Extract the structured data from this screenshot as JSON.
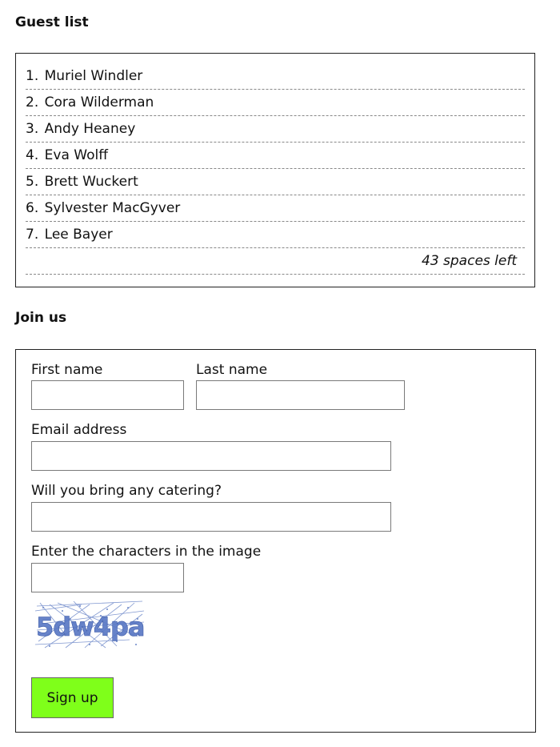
{
  "guest_list": {
    "heading": "Guest list",
    "guests": [
      {
        "number": "1.",
        "name": "Muriel Windler"
      },
      {
        "number": "2.",
        "name": "Cora Wilderman"
      },
      {
        "number": "3.",
        "name": "Andy Heaney"
      },
      {
        "number": "4.",
        "name": "Eva Wolff"
      },
      {
        "number": "5.",
        "name": "Brett Wuckert"
      },
      {
        "number": "6.",
        "name": "Sylvester MacGyver"
      },
      {
        "number": "7.",
        "name": "Lee Bayer"
      }
    ],
    "spaces_left": "43 spaces left"
  },
  "join_form": {
    "heading": "Join us",
    "first_name": {
      "label": "First name",
      "value": "",
      "placeholder": ""
    },
    "last_name": {
      "label": "Last name",
      "value": "",
      "placeholder": ""
    },
    "email": {
      "label": "Email address",
      "value": "",
      "placeholder": ""
    },
    "catering": {
      "label": "Will you bring any catering?",
      "value": "",
      "placeholder": ""
    },
    "captcha": {
      "label": "Enter the characters in the image",
      "value": "",
      "image_text": "5dw4pa"
    },
    "submit_label": "Sign up",
    "colors": {
      "button": "#7fff1a",
      "captcha_text": "#5a78c4"
    }
  }
}
